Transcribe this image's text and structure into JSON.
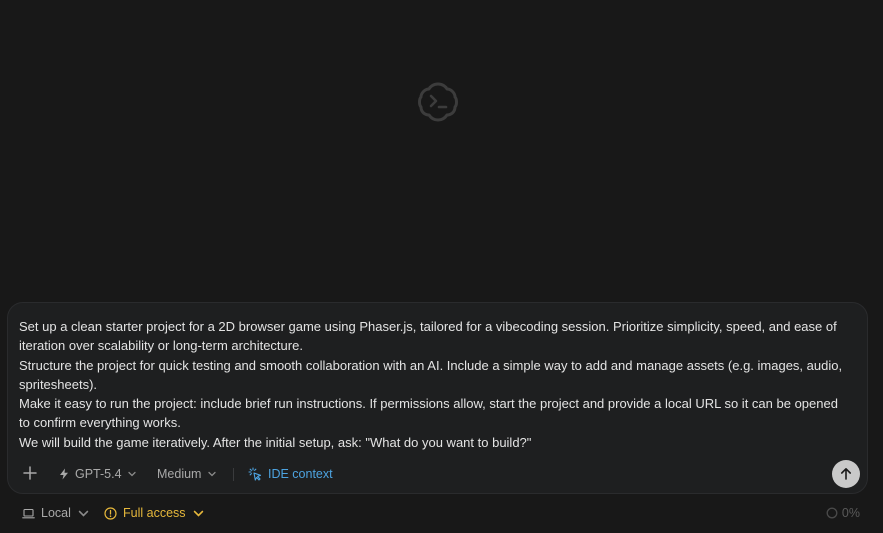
{
  "logo": {
    "icon": "codex-terminal-cloud-icon"
  },
  "composer": {
    "prompt_lines": [
      "Set up a clean starter project for a 2D browser game using Phaser.js, tailored for a vibecoding session. Prioritize simplicity, speed, and ease of iteration over scalability or long-term architecture.",
      "Structure the project for quick testing and smooth collaboration with an AI. Include a simple way to add and manage assets (e.g. images, audio, spritesheets).",
      "Make it easy to run the project: include brief run instructions. If permissions allow, start the project and provide a local URL so it can be opened to confirm everything works.",
      "We will build the game iteratively. After the initial setup, ask: \"What do you want to build?\""
    ],
    "toolbar": {
      "add_icon": "plus-icon",
      "model_label": "GPT-5.4",
      "effort_label": "Medium",
      "ide_context_label": "IDE context",
      "send_icon": "arrow-up-icon"
    }
  },
  "statusbar": {
    "environment_label": "Local",
    "access_label": "Full access",
    "context_usage": "0%"
  },
  "colors": {
    "background": "#181818",
    "composer_bg": "#1e1f20",
    "accent_blue": "#4da3e0",
    "warning_yellow": "#e5b73b",
    "send_button": "#c9c9c9"
  }
}
